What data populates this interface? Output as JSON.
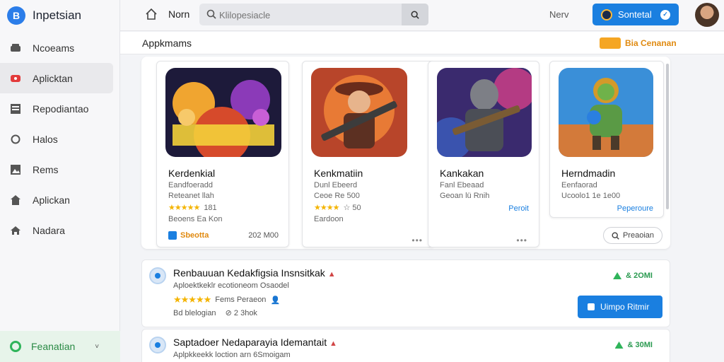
{
  "brand": {
    "name": "Inpetsian"
  },
  "sidebar": {
    "items": [
      {
        "label": "Ncoeams",
        "icon": "car-icon",
        "active": false
      },
      {
        "label": "Aplicktan",
        "icon": "record-icon",
        "active": true
      },
      {
        "label": "Repodiantao",
        "icon": "grid-icon",
        "active": false
      },
      {
        "label": "Halos",
        "icon": "circle-icon",
        "active": false
      },
      {
        "label": "Rems",
        "icon": "image-icon",
        "active": false
      },
      {
        "label": "Aplickan",
        "icon": "home-icon",
        "active": false
      },
      {
        "label": "Nadara",
        "icon": "house-icon",
        "active": false
      }
    ],
    "footer": {
      "label": "Feanatian",
      "chevron": "˅"
    }
  },
  "topbar": {
    "home_label": "Norn",
    "search_placeholder": "Klilopesiacle",
    "next_label": "Nerv",
    "signin_label": "Sontetal"
  },
  "section": {
    "title": "Appkmams",
    "promo_text": "Bia Cenanan"
  },
  "cards": [
    {
      "title": "Kerdenkial",
      "sub1": "Eandfoeradd",
      "sub2": "Reteanet llah",
      "stars": "★★★★★",
      "rating": "181",
      "meta": "Beoens Ea Kon",
      "tag": "Sbeotta",
      "size": "202 M00",
      "art": "sanpalat"
    },
    {
      "title": "Kenkmatiin",
      "sub1": "Dunl Ebeerd",
      "sub2": "Ceoe Re 500",
      "stars": "★★★★",
      "rating": "☆ 50",
      "meta": "Eardoon",
      "dots": "•••",
      "art": "warrior"
    },
    {
      "title": "Kankakan",
      "sub1": "Fanl Ebeaad",
      "sub2": "Geoan lü Rnih",
      "action": "Peroit",
      "dots": "•••",
      "art": "knight"
    },
    {
      "title": "Herndmadin",
      "sub1": "Eenfaorad",
      "sub2": "Ucoolo1 1e 1e00",
      "action": "Peperoure",
      "art": "creature"
    }
  ],
  "preview_button": "Preaoian",
  "list": [
    {
      "title": "Renbauuan Kedakfigsia Insnsitkak",
      "sub": "Aploektkeklr ecotioneom Osaodel",
      "stars": "★★★★★",
      "meta1": "Fems Peraeon",
      "meta2": "Bd blelogian",
      "meta3": "2 3hok",
      "stat": "& 2OMI",
      "button": "Uimpo Ritmir"
    },
    {
      "title": "Saptadoer Nedaparayia Idemantait",
      "sub": "Aplpkkeekk loction arn 6Smoigam",
      "stat": "& 30MI"
    }
  ]
}
